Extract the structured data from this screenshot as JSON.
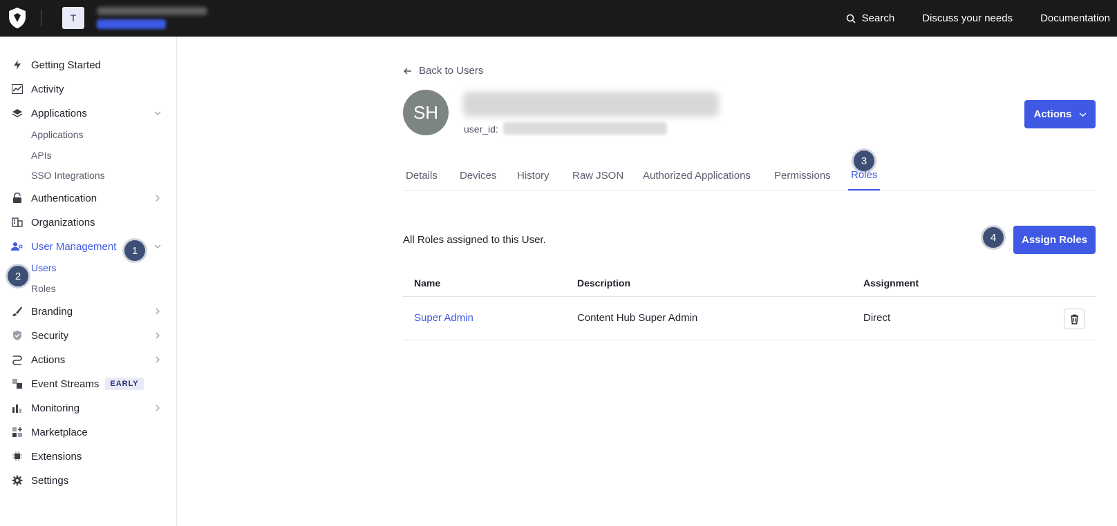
{
  "topbar": {
    "tenant_initial": "T",
    "nav": [
      {
        "label": "Search",
        "icon": "search-icon"
      },
      {
        "label": "Discuss your needs"
      },
      {
        "label": "Documentation"
      }
    ]
  },
  "sidebar": {
    "items": [
      {
        "label": "Getting Started",
        "icon": "bolt-icon"
      },
      {
        "label": "Activity",
        "icon": "trend-chart-icon"
      },
      {
        "label": "Applications",
        "icon": "layers-icon",
        "expanded": true
      },
      {
        "label": "Authentication",
        "icon": "lock-icon"
      },
      {
        "label": "Organizations",
        "icon": "building-icon"
      },
      {
        "label": "User Management",
        "icon": "users-icon",
        "expanded": true,
        "active": true
      },
      {
        "label": "Branding",
        "icon": "brush-icon"
      },
      {
        "label": "Security",
        "icon": "shield-icon"
      },
      {
        "label": "Actions",
        "icon": "flow-icon"
      },
      {
        "label": "Event Streams",
        "icon": "stream-icon",
        "badge": "EARLY"
      },
      {
        "label": "Monitoring",
        "icon": "bar-chart-icon"
      },
      {
        "label": "Marketplace",
        "icon": "grid-plus-icon"
      },
      {
        "label": "Extensions",
        "icon": "chip-icon"
      },
      {
        "label": "Settings",
        "icon": "gear-icon"
      }
    ],
    "applications_sub": [
      "Applications",
      "APIs",
      "SSO Integrations"
    ],
    "user_management_sub": [
      "Users",
      "Roles"
    ]
  },
  "steps": [
    "1",
    "2",
    "3",
    "4"
  ],
  "main": {
    "back_label": "Back to Users",
    "avatar_initials": "SH",
    "user_id_label": "user_id:",
    "actions_label": "Actions",
    "tabs": [
      "Details",
      "Devices",
      "History",
      "Raw JSON",
      "Authorized Applications",
      "Permissions",
      "Roles"
    ],
    "active_tab": "Roles",
    "roles_caption": "All Roles assigned to this User.",
    "assign_label": "Assign Roles",
    "table": {
      "headers": [
        "Name",
        "Description",
        "Assignment"
      ],
      "rows": [
        {
          "name": "Super Admin",
          "description": "Content Hub Super Admin",
          "assignment": "Direct"
        }
      ]
    }
  },
  "colors": {
    "accent": "#3f59e4",
    "topbar": "#1a1a1a",
    "step_marker": "#3d4f75"
  }
}
